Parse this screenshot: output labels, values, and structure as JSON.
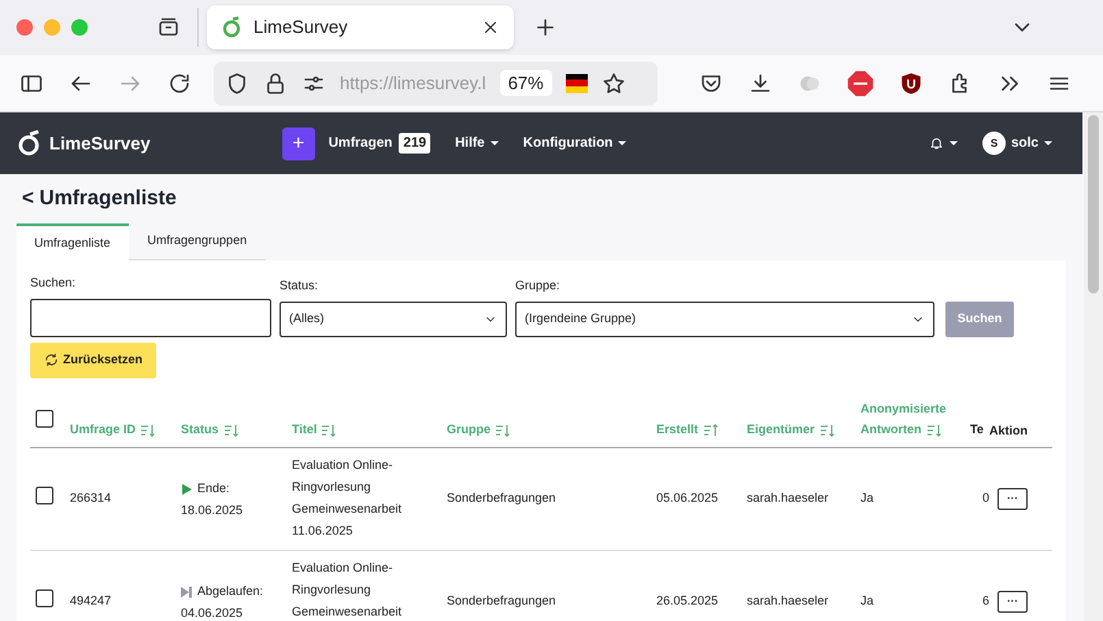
{
  "browser": {
    "tab_title": "LimeSurvey",
    "url": "https://limesurvey.l",
    "zoom": "67%"
  },
  "navbar": {
    "brand": "LimeSurvey",
    "create_button": "+",
    "menu": [
      {
        "label": "Umfragen",
        "badge": "219",
        "dropdown": false
      },
      {
        "label": "Hilfe",
        "dropdown": true
      },
      {
        "label": "Konfiguration",
        "dropdown": true
      }
    ],
    "user_initial": "S",
    "user": "solc"
  },
  "page": {
    "back": "<",
    "title": "Umfragenliste"
  },
  "tabs": [
    {
      "label": "Umfragenliste",
      "selected": true
    },
    {
      "label": "Umfragengruppen",
      "selected": false
    }
  ],
  "filters": {
    "search_label": "Suchen:",
    "status_label": "Status:",
    "status_value": "(Alles)",
    "group_label": "Gruppe:",
    "group_value": "(Irgendeine Gruppe)",
    "search_button": "Suchen",
    "reset_button": "Zurücksetzen"
  },
  "table": {
    "select_all_checked": false,
    "columns": [
      {
        "label": "Umfrage ID",
        "sort_ascending": false
      },
      {
        "label": "Status",
        "sort_ascending": false
      },
      {
        "label": "Titel",
        "sort_ascending": false
      },
      {
        "label": "Gruppe",
        "sort_ascending": false
      },
      {
        "label": "Erstellt",
        "sort_ascending": true
      },
      {
        "label": "Eigentümer",
        "sort_ascending": false
      },
      {
        "label": "Anonymisierte Antworten",
        "sort_ascending": false
      },
      {
        "label": "Te"
      }
    ],
    "action_column": "Aktion",
    "action_button": "···",
    "rows": [
      {
        "checked": false,
        "id": "266314",
        "kind": "active",
        "status": "Ende: 18.06.2025",
        "title": "Evaluation Online-Ringvorlesung Gemeinwesenarbeit 11.06.2025",
        "group": "Sonderbefragungen",
        "created": "05.06.2025",
        "owner": "sarah.haeseler",
        "anonymized": "Ja",
        "responses": "0"
      },
      {
        "checked": false,
        "id": "494247",
        "kind": "expired",
        "status": "Abgelaufen: 04.06.2025",
        "title": "Evaluation Online-Ringvorlesung Gemeinwesenarbeit",
        "group": "Sonderbefragungen",
        "created": "26.05.2025",
        "owner": "sarah.haeseler",
        "anonymized": "Ja",
        "responses": "6"
      }
    ]
  }
}
